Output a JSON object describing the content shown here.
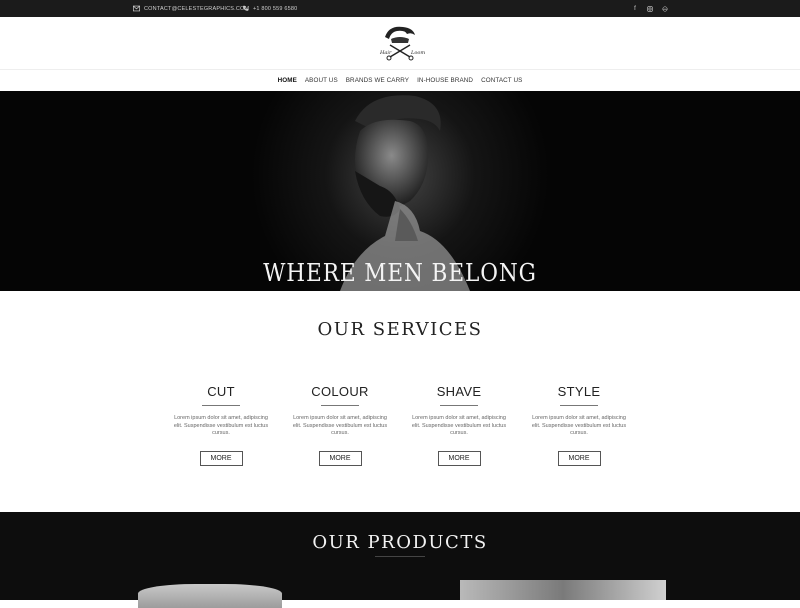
{
  "topbar": {
    "email": "CONTACT@CELESTEGRAPHICS.COM",
    "phone": "+1 800 559 6580",
    "social": [
      "facebook-icon",
      "instagram-icon",
      "tripadvisor-icon"
    ]
  },
  "logo": {
    "text_top": "Hair",
    "text_bottom": "Loom"
  },
  "nav": [
    {
      "label": "HOME",
      "active": true
    },
    {
      "label": "ABOUT US"
    },
    {
      "label": "BRANDS WE CARRY"
    },
    {
      "label": "IN-HOUSE BRAND"
    },
    {
      "label": "CONTACT US"
    }
  ],
  "hero": {
    "caption": "WHERE MEN BELONG"
  },
  "services": {
    "title": "OUR SERVICES",
    "items": [
      {
        "name": "CUT",
        "text": "Lorem ipsum dolor sit amet, adipiscing elit. Suspendisse vestibulum est luctus cursus.",
        "more": "MORE"
      },
      {
        "name": "COLOUR",
        "text": "Lorem ipsum dolor sit amet, adipiscing elit. Suspendisse vestibulum est luctus cursus.",
        "more": "MORE"
      },
      {
        "name": "SHAVE",
        "text": "Lorem ipsum dolor sit amet, adipiscing elit. Suspendisse vestibulum est luctus cursus.",
        "more": "MORE"
      },
      {
        "name": "STYLE",
        "text": "Lorem ipsum dolor sit amet, adipiscing elit. Suspendisse vestibulum est luctus cursus.",
        "more": "MORE"
      }
    ]
  },
  "products": {
    "title": "OUR PRODUCTS"
  },
  "colors": {
    "topbar": "#1b1b1b",
    "hero_bg": "#050505",
    "products_bg": "#0d0d0d"
  }
}
